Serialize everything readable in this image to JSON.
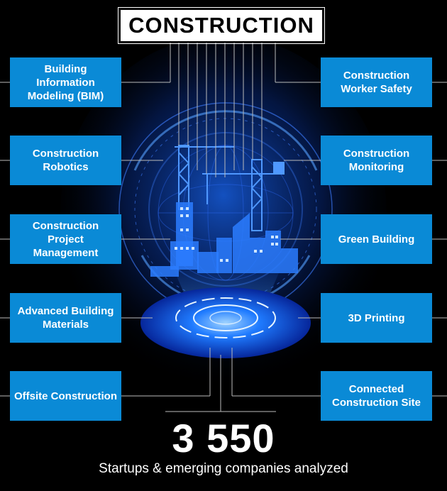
{
  "title": "CONSTRUCTION",
  "left_tiles": [
    "Building Information Modeling (BIM)",
    "Construction Robotics",
    "Construction Project Management",
    "Advanced Building Materials",
    "Offsite Construction"
  ],
  "right_tiles": [
    "Construction Worker Safety",
    "Construction Monitoring",
    "Green Building",
    "3D Printing",
    "Connected Construction Site"
  ],
  "stat": {
    "number": "3 550",
    "caption": "Startups & emerging companies analyzed"
  },
  "colors": {
    "tile": "#0a8ad6",
    "glow": "#1a6bff",
    "background": "#000000"
  }
}
